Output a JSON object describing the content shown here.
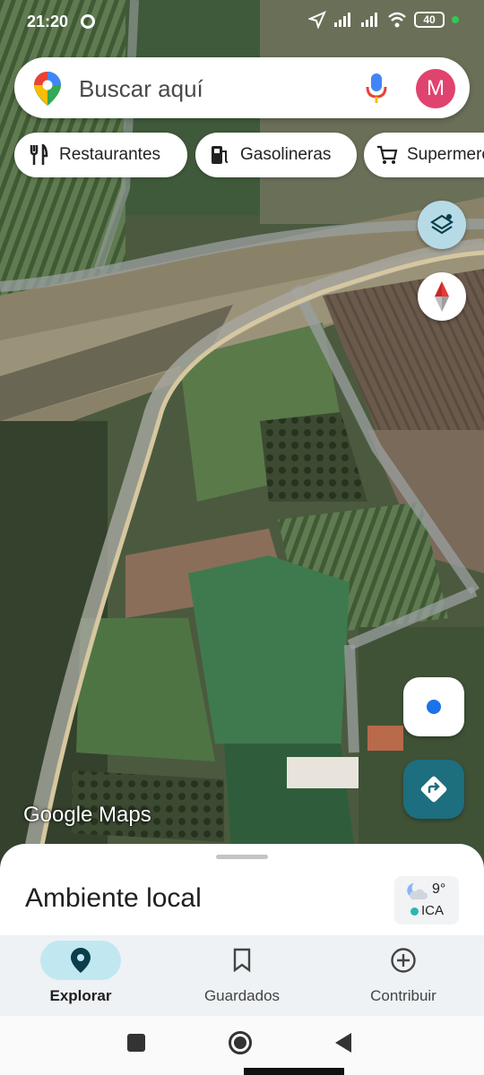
{
  "status_bar": {
    "time": "21:20",
    "battery": "40"
  },
  "search": {
    "placeholder": "Buscar aquí",
    "avatar_letter": "M"
  },
  "chips": [
    {
      "label": "Restaurantes",
      "icon": "restaurant-icon"
    },
    {
      "label": "Gasolineras",
      "icon": "gas-station-icon"
    },
    {
      "label": "Supermercados",
      "icon": "shopping-cart-icon"
    }
  ],
  "map": {
    "attribution": "Google Maps",
    "layer": "satellite"
  },
  "sheet": {
    "title": "Ambiente local",
    "temperature": "9°",
    "aqi_label": "ICA"
  },
  "nav": [
    {
      "label": "Explorar",
      "icon": "location-pin-icon",
      "active": true
    },
    {
      "label": "Guardados",
      "icon": "bookmark-icon",
      "active": false
    },
    {
      "label": "Contribuir",
      "icon": "add-circle-icon",
      "active": false
    }
  ],
  "colors": {
    "accent": "#1d6e7e",
    "avatar": "#e0436d",
    "nav_active_pill": "#c1e8f1"
  }
}
